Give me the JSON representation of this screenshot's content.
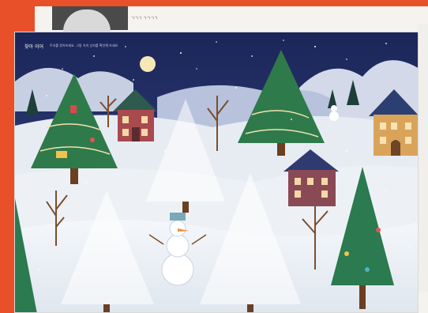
{
  "background_page": {
    "header_text": "ㄱㄱㄱ ㄱㄱㄱㄱ",
    "photo_caption": "ㄱㄱㄱ"
  },
  "card": {
    "title": "찾아 이어",
    "subtitle": "트리를 찾아보세요. 그림 속의 상자를 확인해 보세요"
  },
  "colors": {
    "frame": "#e8502a",
    "sky": "#1e2b66",
    "snow": "#eef2f6",
    "tree": "#2f7a4a",
    "trunk": "#6b3f22"
  }
}
